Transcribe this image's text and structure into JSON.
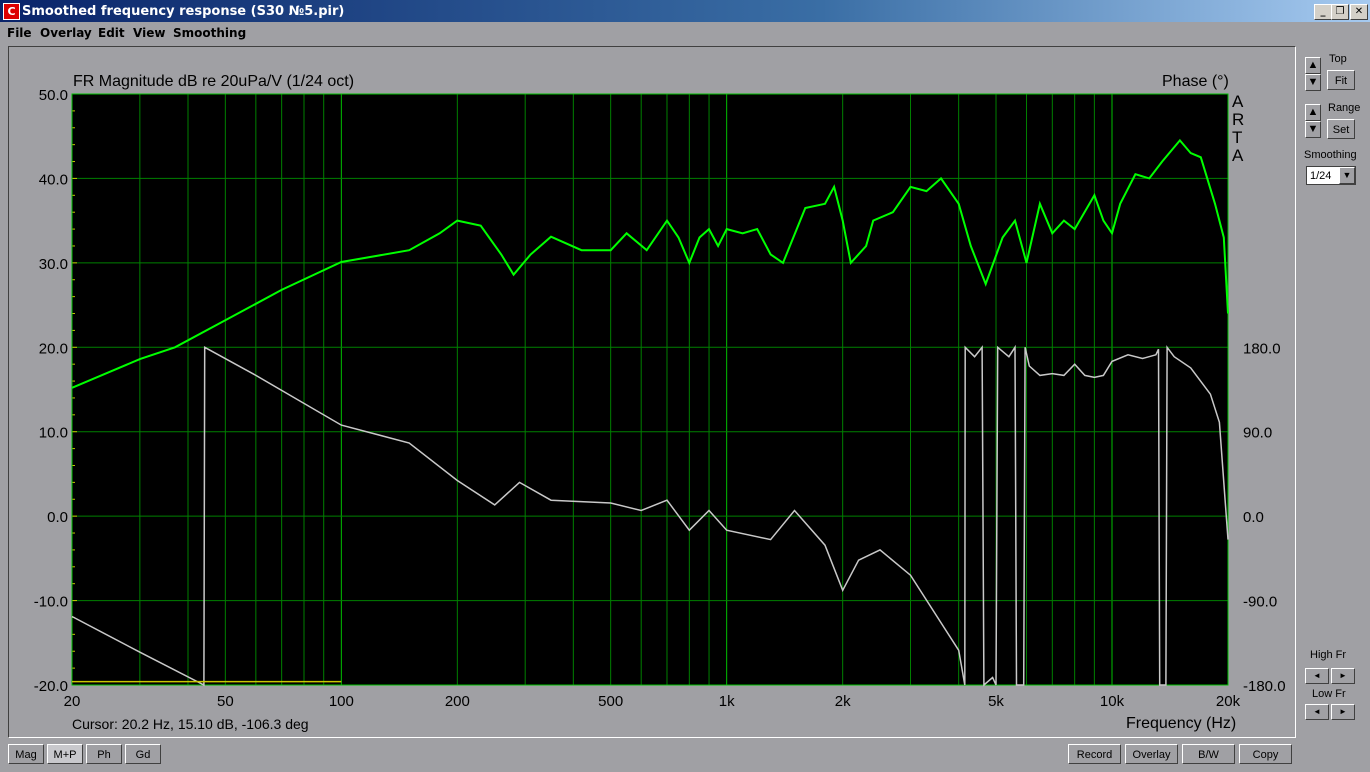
{
  "window": {
    "title": "Smoothed frequency response (S30 №5.pir)",
    "min": "_",
    "restore": "❐",
    "close": "✕"
  },
  "menu": [
    "File",
    "Overlay",
    "Edit",
    "View",
    "Smoothing"
  ],
  "right_panel": {
    "top_label": "Top",
    "fit": "Fit",
    "range_label": "Range",
    "set": "Set",
    "smoothing_label": "Smoothing",
    "smoothing_value": "1/24",
    "high_fr": "High Fr",
    "low_fr": "Low Fr",
    "up": "▲",
    "down": "▼",
    "left": "◄",
    "right": "►"
  },
  "bottom_left": [
    "Mag",
    "M+P",
    "Ph",
    "Gd"
  ],
  "bottom_right": [
    "Record",
    "Overlay",
    "B/W",
    "Copy"
  ],
  "cursor": "Cursor: 20.2 Hz, 15.10 dB, -106.3 deg",
  "chart_data": {
    "type": "line",
    "title": "FR Magnitude dB re 20uPa/V (1/24 oct)",
    "y2label": "Phase (°)",
    "xlabel": "Frequency (Hz)",
    "watermark": [
      "A",
      "R",
      "T",
      "A"
    ],
    "xscale": "log",
    "xlim": [
      20,
      20000
    ],
    "ylim": [
      -20,
      50
    ],
    "y2lim": [
      -180,
      180
    ],
    "xticks": [
      {
        "v": 20,
        "l": "20"
      },
      {
        "v": 50,
        "l": "50"
      },
      {
        "v": 100,
        "l": "100"
      },
      {
        "v": 200,
        "l": "200"
      },
      {
        "v": 500,
        "l": "500"
      },
      {
        "v": 1000,
        "l": "1k"
      },
      {
        "v": 2000,
        "l": "2k"
      },
      {
        "v": 5000,
        "l": "5k"
      },
      {
        "v": 10000,
        "l": "10k"
      },
      {
        "v": 20000,
        "l": "20k"
      }
    ],
    "yticks": [
      "50.0",
      "40.0",
      "30.0",
      "20.0",
      "10.0",
      "0.0",
      "-10.0",
      "-20.0"
    ],
    "y2ticks": [
      "180.0",
      "90.0",
      "0.0",
      "-90.0",
      "-180.0"
    ],
    "colors": {
      "magnitude": "#00ff00",
      "phase": "#c8c8c8",
      "reference": "#c8c800",
      "grid": "#008000",
      "gridMajor": "#00c000"
    },
    "series": [
      {
        "name": "Magnitude",
        "axis": "left",
        "points": [
          [
            20,
            15.2
          ],
          [
            30,
            18.6
          ],
          [
            37,
            20
          ],
          [
            50,
            23.2
          ],
          [
            70,
            26.8
          ],
          [
            100,
            30.1
          ],
          [
            150,
            31.5
          ],
          [
            180,
            33.5
          ],
          [
            200,
            35
          ],
          [
            230,
            34.4
          ],
          [
            260,
            31
          ],
          [
            280,
            28.6
          ],
          [
            310,
            31
          ],
          [
            350,
            33.1
          ],
          [
            420,
            31.5
          ],
          [
            500,
            31.5
          ],
          [
            550,
            33.5
          ],
          [
            620,
            31.5
          ],
          [
            700,
            35
          ],
          [
            750,
            33
          ],
          [
            800,
            30
          ],
          [
            850,
            33
          ],
          [
            900,
            34
          ],
          [
            950,
            32
          ],
          [
            1000,
            34
          ],
          [
            1100,
            33.5
          ],
          [
            1200,
            34
          ],
          [
            1300,
            31
          ],
          [
            1400,
            30
          ],
          [
            1600,
            36.5
          ],
          [
            1800,
            37
          ],
          [
            1900,
            39
          ],
          [
            2000,
            35
          ],
          [
            2100,
            30
          ],
          [
            2300,
            32
          ],
          [
            2400,
            35
          ],
          [
            2700,
            36
          ],
          [
            3000,
            39
          ],
          [
            3300,
            38.5
          ],
          [
            3600,
            40
          ],
          [
            4000,
            37
          ],
          [
            4300,
            32
          ],
          [
            4700,
            27.5
          ],
          [
            5200,
            33
          ],
          [
            5600,
            35
          ],
          [
            6000,
            30
          ],
          [
            6500,
            37
          ],
          [
            7000,
            33.5
          ],
          [
            7500,
            35
          ],
          [
            8000,
            34
          ],
          [
            9000,
            38
          ],
          [
            9500,
            35
          ],
          [
            10000,
            33.5
          ],
          [
            10500,
            37
          ],
          [
            11500,
            40.5
          ],
          [
            12500,
            40
          ],
          [
            13500,
            42
          ],
          [
            15000,
            44.5
          ],
          [
            16000,
            43
          ],
          [
            17000,
            42.5
          ],
          [
            18500,
            37
          ],
          [
            19500,
            33
          ],
          [
            20000,
            24
          ]
        ]
      },
      {
        "name": "Phase",
        "axis": "right",
        "points": [
          [
            20,
            -107
          ],
          [
            30,
            -145
          ],
          [
            44,
            -180
          ],
          [
            44.2,
            180
          ],
          [
            60,
            150
          ],
          [
            100,
            97
          ],
          [
            150,
            78
          ],
          [
            200,
            38
          ],
          [
            250,
            12
          ],
          [
            290,
            36
          ],
          [
            350,
            17
          ],
          [
            500,
            14
          ],
          [
            600,
            6
          ],
          [
            700,
            17
          ],
          [
            800,
            -15
          ],
          [
            900,
            6
          ],
          [
            1000,
            -15
          ],
          [
            1300,
            -25
          ],
          [
            1500,
            6
          ],
          [
            1800,
            -31
          ],
          [
            2000,
            -79
          ],
          [
            2200,
            -47
          ],
          [
            2500,
            -36
          ],
          [
            3000,
            -63
          ],
          [
            4000,
            -143
          ],
          [
            4150,
            -180
          ],
          [
            4160,
            180
          ],
          [
            4400,
            170
          ],
          [
            4600,
            180
          ],
          [
            4650,
            -180
          ],
          [
            4900,
            -172
          ],
          [
            5000,
            -180
          ],
          [
            5050,
            180
          ],
          [
            5400,
            170
          ],
          [
            5600,
            180
          ],
          [
            5650,
            -180
          ],
          [
            5900,
            -180
          ],
          [
            5950,
            180
          ],
          [
            6100,
            160
          ],
          [
            6500,
            150
          ],
          [
            7000,
            152
          ],
          [
            7500,
            150
          ],
          [
            8000,
            162
          ],
          [
            8500,
            150
          ],
          [
            9000,
            148
          ],
          [
            9500,
            150
          ],
          [
            10000,
            165
          ],
          [
            11000,
            172
          ],
          [
            12000,
            168
          ],
          [
            13000,
            172
          ],
          [
            13200,
            178
          ],
          [
            13300,
            -180
          ],
          [
            13800,
            -180
          ],
          [
            13900,
            180
          ],
          [
            14500,
            170
          ],
          [
            16000,
            158
          ],
          [
            18000,
            130
          ],
          [
            19000,
            100
          ],
          [
            20000,
            -25
          ]
        ]
      },
      {
        "name": "Reference",
        "axis": "left",
        "points": [
          [
            20,
            -19.6
          ],
          [
            100,
            -19.6
          ]
        ]
      }
    ]
  }
}
